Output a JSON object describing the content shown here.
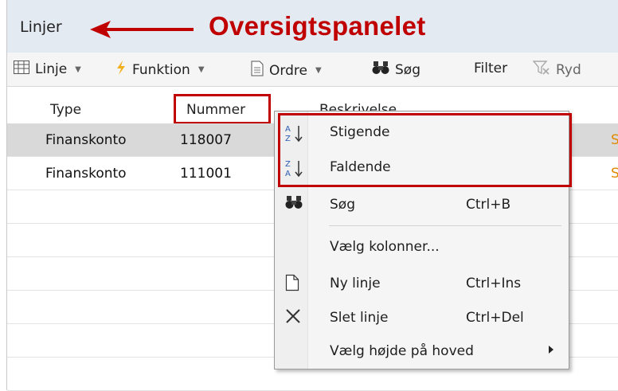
{
  "panel": {
    "title": "Linjer"
  },
  "annotation": {
    "text": "Oversigtspanelet",
    "color": "#c00000"
  },
  "toolbar": {
    "items": [
      {
        "label": "Linje",
        "icon": "grid-icon",
        "has_dropdown": true
      },
      {
        "label": "Funktion",
        "icon": "lightning-icon",
        "has_dropdown": true
      },
      {
        "label": "Ordre",
        "icon": "document-icon",
        "has_dropdown": true
      },
      {
        "label": "Søg",
        "icon": "binoculars-icon",
        "has_dropdown": false
      },
      {
        "label": "Filter",
        "icon": "",
        "has_dropdown": false
      },
      {
        "label": "Ryd",
        "icon": "clear-filter-icon",
        "has_dropdown": false
      }
    ]
  },
  "grid": {
    "columns": [
      "Type",
      "Nummer",
      "Beskrivelse"
    ],
    "rows": [
      {
        "type": "Finanskonto",
        "nummer": "118007",
        "selected": true
      },
      {
        "type": "Finanskonto",
        "nummer": "111001",
        "selected": false
      }
    ]
  },
  "context_menu": {
    "items": [
      {
        "label": "Stigende",
        "icon": "sort-ascending-icon",
        "shortcut": ""
      },
      {
        "label": "Faldende",
        "icon": "sort-descending-icon",
        "shortcut": ""
      },
      {
        "label": "Søg",
        "icon": "binoculars-icon",
        "shortcut": "Ctrl+B"
      },
      {
        "label": "Vælg kolonner...",
        "icon": "",
        "shortcut": ""
      },
      {
        "label": "Ny linje",
        "icon": "new-document-icon",
        "shortcut": "Ctrl+Ins"
      },
      {
        "label": "Slet linje",
        "icon": "delete-icon",
        "shortcut": "Ctrl+Del"
      },
      {
        "label": "Vælg højde på hoved",
        "icon": "",
        "shortcut": "",
        "has_submenu": true
      }
    ]
  },
  "colors": {
    "highlight": "#c00000",
    "selected_row": "#d9d9d9",
    "header_bg": "#e3eaf2"
  }
}
